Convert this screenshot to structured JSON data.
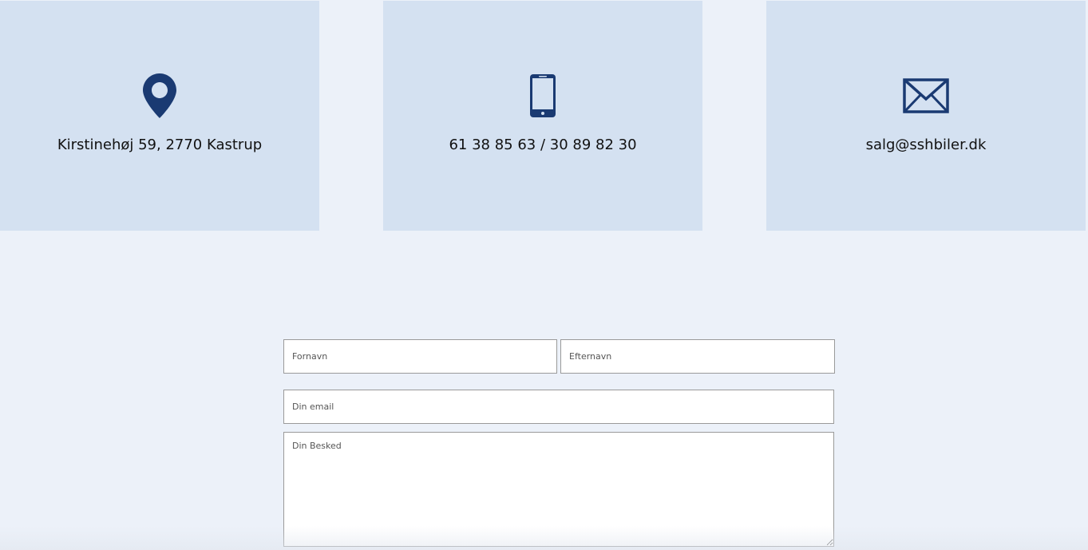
{
  "contact_cards": [
    {
      "icon": "map-pin-icon",
      "text": "Kirstinehøj 59, 2770 Kastrup"
    },
    {
      "icon": "mobile-phone-icon",
      "text": "61 38 85 63 / 30 89 82 30"
    },
    {
      "icon": "envelope-icon",
      "text": "salg@sshbiler.dk"
    }
  ],
  "form": {
    "first_name_placeholder": "Fornavn",
    "last_name_placeholder": "Efternavn",
    "email_placeholder": "Din email",
    "message_placeholder": "Din Besked"
  },
  "colors": {
    "page_background": "#ecf1f9",
    "card_background": "#d4e1f1",
    "icon": "#1a3a72"
  }
}
